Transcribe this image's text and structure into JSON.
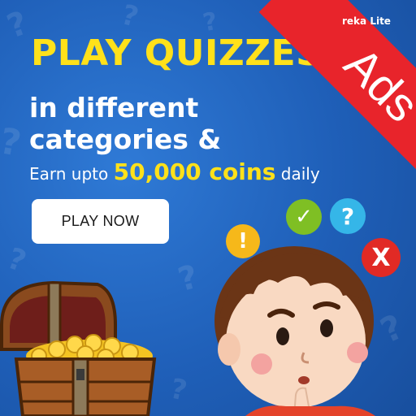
{
  "ad": {
    "headline": "PLAY QUIZZES",
    "subline1": "in different",
    "subline2": "categories &",
    "earn_prefix": "Earn upto",
    "earn_highlight": "50,000 coins",
    "earn_suffix": "daily",
    "cta_label": "PLAY NOW",
    "brand_text": "reka Lite",
    "ribbon_label": "Ads"
  },
  "colors": {
    "background": "#1f5fb8",
    "headline_yellow": "#ffe11a",
    "ribbon_red": "#e8242b",
    "button_white": "#ffffff"
  },
  "icons": {
    "exclamation": "!",
    "check": "✓",
    "question": "?",
    "cross": "X"
  }
}
